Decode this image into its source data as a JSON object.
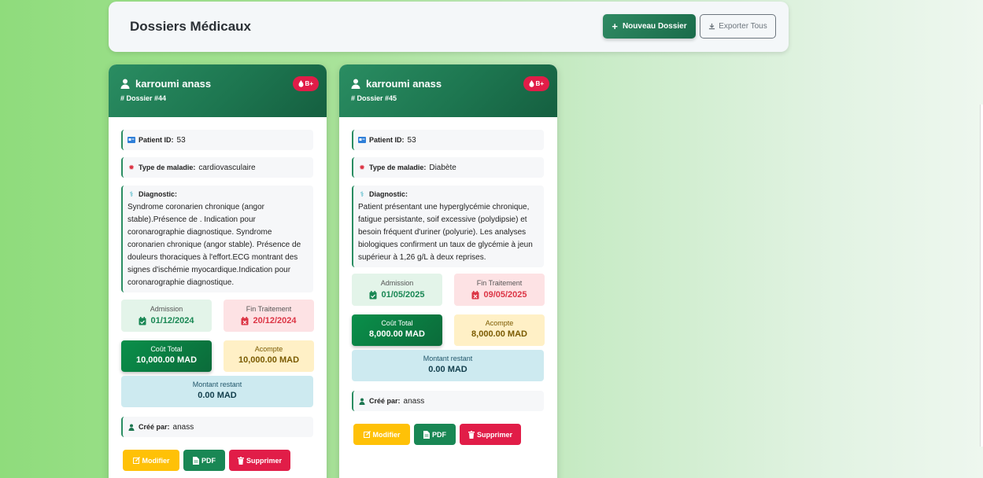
{
  "header": {
    "title": "Dossiers Médicaux",
    "new_button": "Nouveau Dossier",
    "export_button": "Exporter Tous"
  },
  "cards": [
    {
      "patient_name": "karroumi anass",
      "dossier": "Dossier #44",
      "blood_type": "B+",
      "patient_id_label": "Patient ID:",
      "patient_id": "53",
      "maladie_label": "Type de maladie:",
      "maladie": "cardiovasculaire",
      "diagnostic_label": "Diagnostic:",
      "diagnostic": "Syndrome coronarien chronique (angor stable).Présence de . Indication pour coronarographie diagnostique. Syndrome coronarien chronique (angor stable). Présence de douleurs thoraciques à l'effort.ECG montrant des signes d'ischémie myocardique.Indication pour coronarographie diagnostique.",
      "admission_label": "Admission",
      "admission": "01/12/2024",
      "fin_label": "Fin Traitement",
      "fin": "20/12/2024",
      "cout_label": "Coût Total",
      "cout": "10,000.00 MAD",
      "acompte_label": "Acompte",
      "acompte": "10,000.00 MAD",
      "restant_label": "Montant restant",
      "restant": "0.00 MAD",
      "cree_label": "Créé par:",
      "cree": "anass",
      "modifier": "Modifier",
      "pdf": "PDF",
      "supprimer": "Supprimer"
    },
    {
      "patient_name": "karroumi anass",
      "dossier": "Dossier #45",
      "blood_type": "B+",
      "patient_id_label": "Patient ID:",
      "patient_id": "53",
      "maladie_label": "Type de maladie:",
      "maladie": "Diabète",
      "diagnostic_label": "Diagnostic:",
      "diagnostic": "Patient présentant une hyperglycémie chronique, fatigue persistante, soif excessive (polydipsie) et besoin fréquent d'uriner (polyurie). Les analyses biologiques confirment un taux de glycémie à jeun supérieur à 1,26 g/L à deux reprises.",
      "admission_label": "Admission",
      "admission": "01/05/2025",
      "fin_label": "Fin Traitement",
      "fin": "09/05/2025",
      "cout_label": "Coût Total",
      "cout": "8,000.00 MAD",
      "acompte_label": "Acompte",
      "acompte": "8,000.00 MAD",
      "restant_label": "Montant restant",
      "restant": "0.00 MAD",
      "cree_label": "Créé par:",
      "cree": "anass",
      "modifier": "Modifier",
      "pdf": "PDF",
      "supprimer": "Supprimer"
    }
  ],
  "colors": {
    "primary_green": "#1d7650",
    "danger": "#e11d48",
    "warning": "#ffc107",
    "success": "#198754"
  }
}
